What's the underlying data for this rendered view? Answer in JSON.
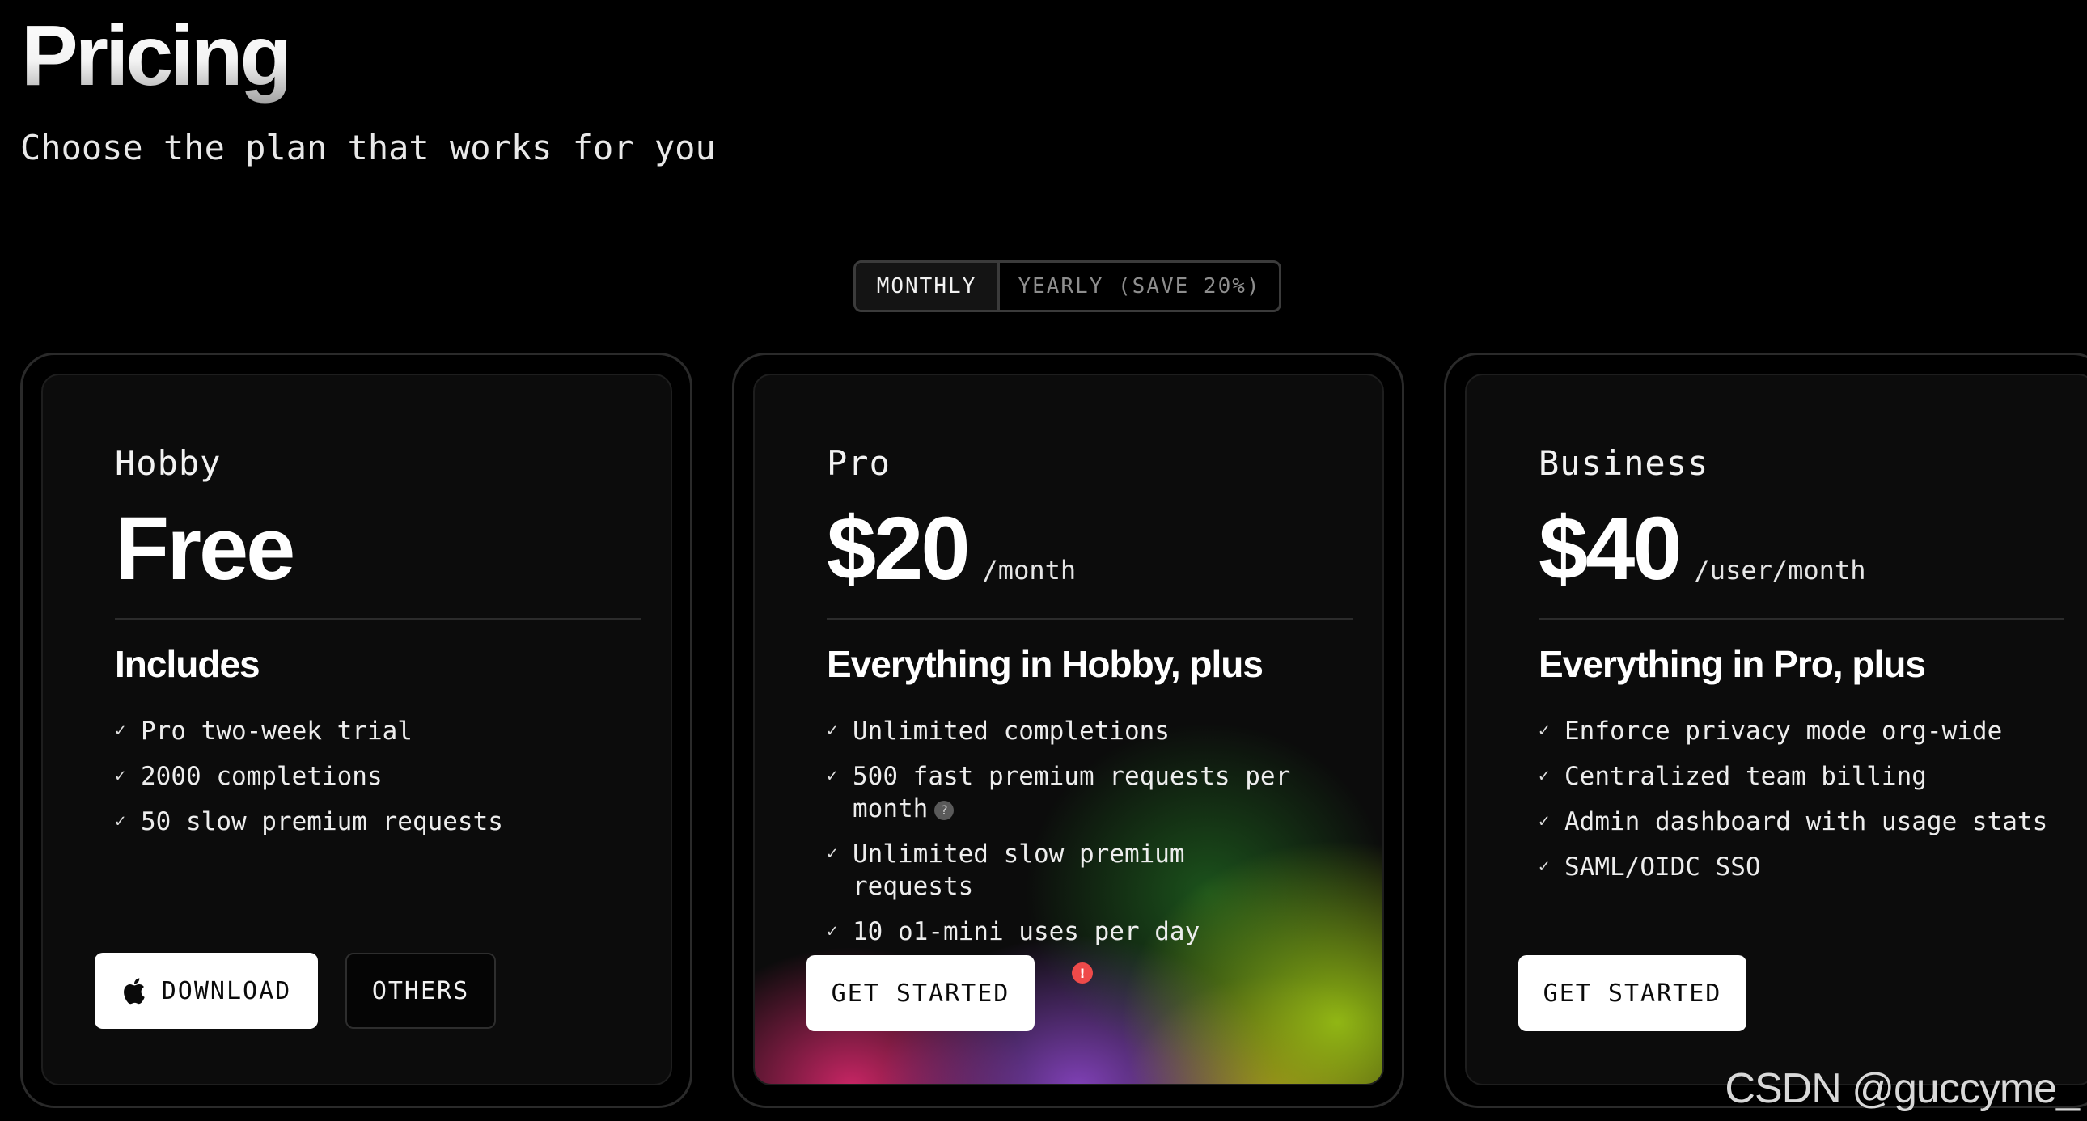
{
  "header": {
    "title": "Pricing",
    "subtitle": "Choose the plan that works for you"
  },
  "billing_toggle": {
    "monthly_label": "MONTHLY",
    "yearly_label": "YEARLY (SAVE 20%)",
    "selected": "monthly"
  },
  "plans": [
    {
      "name": "Hobby",
      "price": "Free",
      "period": "",
      "includes_title": "Includes",
      "features": [
        "Pro two-week trial",
        "2000 completions",
        "50 slow premium requests"
      ],
      "primary_button": "DOWNLOAD",
      "primary_icon": "apple-icon",
      "secondary_button": "OTHERS"
    },
    {
      "name": "Pro",
      "price": "$20",
      "period": "/month",
      "includes_title": "Everything in Hobby, plus",
      "features": [
        "Unlimited completions",
        "500 fast premium requests per month",
        "Unlimited slow premium requests",
        "10 o1-mini uses per day"
      ],
      "primary_button": "GET STARTED",
      "alert_badge": "!"
    },
    {
      "name": "Business",
      "price": "$40",
      "period": "/user/month",
      "includes_title": "Everything in Pro, plus",
      "features": [
        "Enforce privacy mode org-wide",
        "Centralized team billing",
        "Admin dashboard with usage stats",
        "SAML/OIDC SSO"
      ],
      "primary_button": "GET STARTED"
    }
  ],
  "icons": {
    "check": "✓",
    "help": "?"
  },
  "colors": {
    "background": "#000000",
    "card": "#0c0c0c",
    "alert": "#ef4a4a"
  },
  "watermark": "CSDN @guccyme_"
}
